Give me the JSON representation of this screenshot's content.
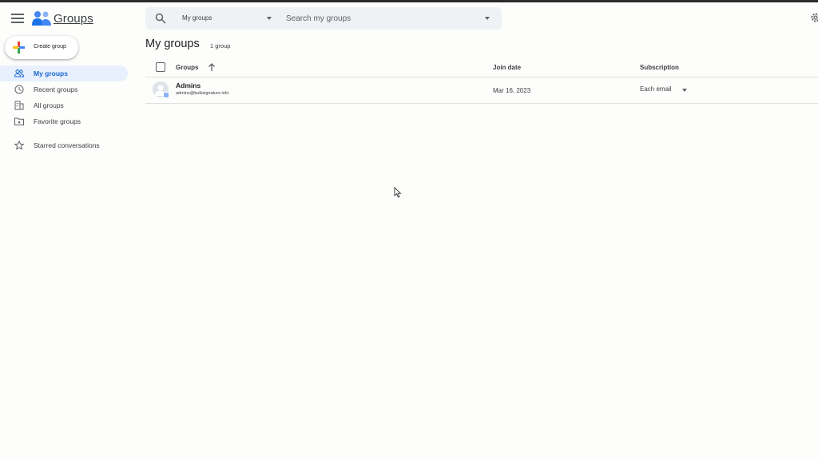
{
  "app": {
    "title": "Groups",
    "brand_color": "#1a73e8"
  },
  "search": {
    "scope": "My groups",
    "placeholder": "Search my groups"
  },
  "sidebar": {
    "create_label": "Create group",
    "items": [
      {
        "label": "My groups",
        "icon": "people-icon",
        "active": true
      },
      {
        "label": "Recent groups",
        "icon": "clock-icon",
        "active": false
      },
      {
        "label": "All groups",
        "icon": "building-icon",
        "active": false
      },
      {
        "label": "Favorite groups",
        "icon": "folder-star-icon",
        "active": false
      },
      {
        "label": "Starred conversations",
        "icon": "star-icon",
        "active": false
      }
    ]
  },
  "main": {
    "title": "My groups",
    "count": "1 group",
    "columns": {
      "groups": "Groups",
      "join_date": "Join date",
      "subscription": "Subscription"
    },
    "rows": [
      {
        "name": "Admins",
        "email": "admins@bulksignature.info",
        "join_date": "Mar 16, 2023",
        "subscription": "Each email"
      }
    ]
  }
}
